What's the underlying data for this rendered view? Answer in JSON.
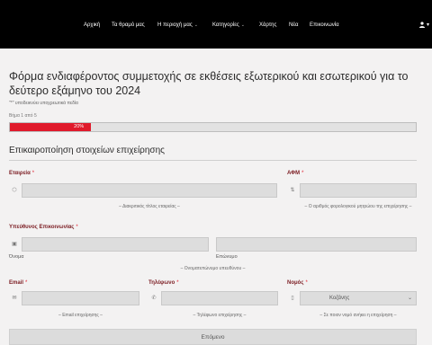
{
  "nav": {
    "items": [
      {
        "label": "Αρχική",
        "has_dropdown": false
      },
      {
        "label": "Τα θραμό μας",
        "has_dropdown": false
      },
      {
        "label": "Η περιοχή μας",
        "has_dropdown": true
      },
      {
        "label": "Κατηγορίες",
        "has_dropdown": true
      },
      {
        "label": "Χάρτης",
        "has_dropdown": false
      },
      {
        "label": "Νέα",
        "has_dropdown": false
      },
      {
        "label": "Επικοινωνία",
        "has_dropdown": false
      }
    ],
    "chevron": "⌄",
    "user_icon": "user-icon",
    "user_caret": "▾"
  },
  "form": {
    "title": "Φόρμα ενδιαφέροντος συμμετοχής σε εκθέσεις εξωτερικού και εσωτερικού για το δεύτερο εξάμηνο του 2024",
    "required_note": "\"*\" υποδεικνύει υποχρεωτικά πεδία",
    "step_text": "Βήμα 1 από 5",
    "progress": {
      "percent": 20,
      "label": "20%",
      "color": "#e01a2b"
    },
    "section_title": "Επικαιροποίηση στοιχείων επιχείρησης",
    "required_star": "*",
    "fields": {
      "company": {
        "label": "Εταιρεία",
        "help": "– Διακριτικός τίτλος εταιρείας –",
        "icon": "building-icon",
        "icon_glyph": "⬡"
      },
      "afm": {
        "label": "ΑΦΜ",
        "help": "– Ο αριθμός φορολογικού μητρώου της επιχείρησης –",
        "icon": "sort-numeric-icon",
        "icon_glyph": "⇅"
      },
      "contact": {
        "label": "Υπεύθυνος Επικοινωνίας",
        "first_sub": "Όνομα",
        "last_sub": "Επώνυμο",
        "help": "– Ονοματεπώνυμο υπευθύνου –",
        "icon": "id-card-icon",
        "icon_glyph": "▣"
      },
      "email": {
        "label": "Email",
        "help": "– Email επιχείρησης –",
        "icon": "envelope-icon",
        "icon_glyph": "✉"
      },
      "phone": {
        "label": "Τηλέφωνο",
        "help": "– Τηλέφωνο επιχείρησης –",
        "icon": "phone-icon",
        "icon_glyph": "✆"
      },
      "prefecture": {
        "label": "Νομός",
        "value": "Κοζάνης",
        "help": "– Σε ποιον νομό ανήκει η επιχείρηση –",
        "icon": "mobile-icon",
        "icon_glyph": "▯",
        "chevron": "⌄"
      }
    },
    "next_button": "Επόμενο"
  }
}
